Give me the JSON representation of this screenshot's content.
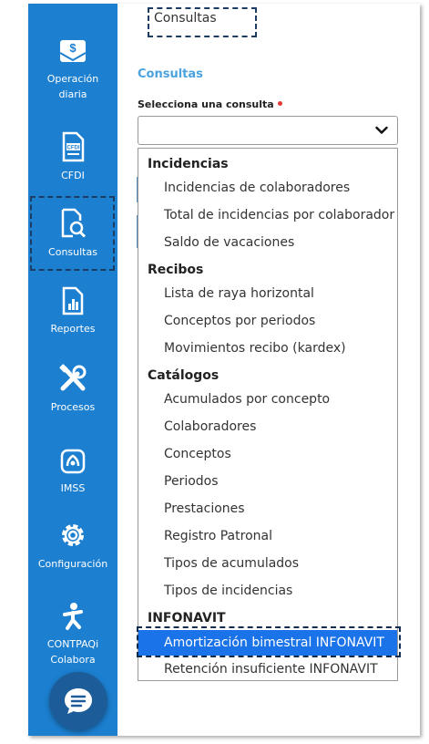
{
  "sidebar": {
    "items": [
      {
        "label_line1": "Operación",
        "label_line2": "diaria",
        "icon": "money-envelope-icon"
      },
      {
        "label_line1": "CFDI",
        "label_line2": "",
        "icon": "cfdi-document-icon"
      },
      {
        "label_line1": "Consultas",
        "label_line2": "",
        "icon": "document-search-icon"
      },
      {
        "label_line1": "Reportes",
        "label_line2": "",
        "icon": "report-chart-icon"
      },
      {
        "label_line1": "Procesos",
        "label_line2": "",
        "icon": "tools-icon"
      },
      {
        "label_line1": "IMSS",
        "label_line2": "",
        "icon": "imss-icon"
      },
      {
        "label_line1": "Configuración",
        "label_line2": "",
        "icon": "gear-icon"
      },
      {
        "label_line1": "CONTPAQi",
        "label_line2": "Colabora",
        "icon": "person-running-icon"
      }
    ],
    "chat_icon": "chat-bubble-icon"
  },
  "breadcrumb": "Consultas",
  "section_title": "Consultas",
  "select": {
    "label": "Selecciona una consulta",
    "value": ""
  },
  "dropdown": {
    "groups": [
      {
        "name": "Incidencias",
        "options": [
          "Incidencias de colaboradores",
          "Total de incidencias por colaborador",
          "Saldo de vacaciones"
        ]
      },
      {
        "name": "Recibos",
        "options": [
          "Lista de raya horizontal",
          "Conceptos por periodos",
          "Movimientos recibo (kardex)"
        ]
      },
      {
        "name": "Catálogos",
        "options": [
          "Acumulados por concepto",
          "Colaboradores",
          "Conceptos",
          "Periodos",
          "Prestaciones",
          "Registro Patronal",
          "Tipos de acumulados",
          "Tipos de incidencias"
        ]
      },
      {
        "name": "INFONAVIT",
        "options": [
          "Amortización bimestral INFONAVIT",
          "Retención insuficiente INFONAVIT"
        ]
      }
    ],
    "highlighted": "Amortización bimestral INFONAVIT"
  },
  "colors": {
    "sidebar": "#1c7fd0",
    "accent_title": "#4aa3df",
    "highlight": "#1a73e8",
    "chat_button": "#1c5d99"
  }
}
